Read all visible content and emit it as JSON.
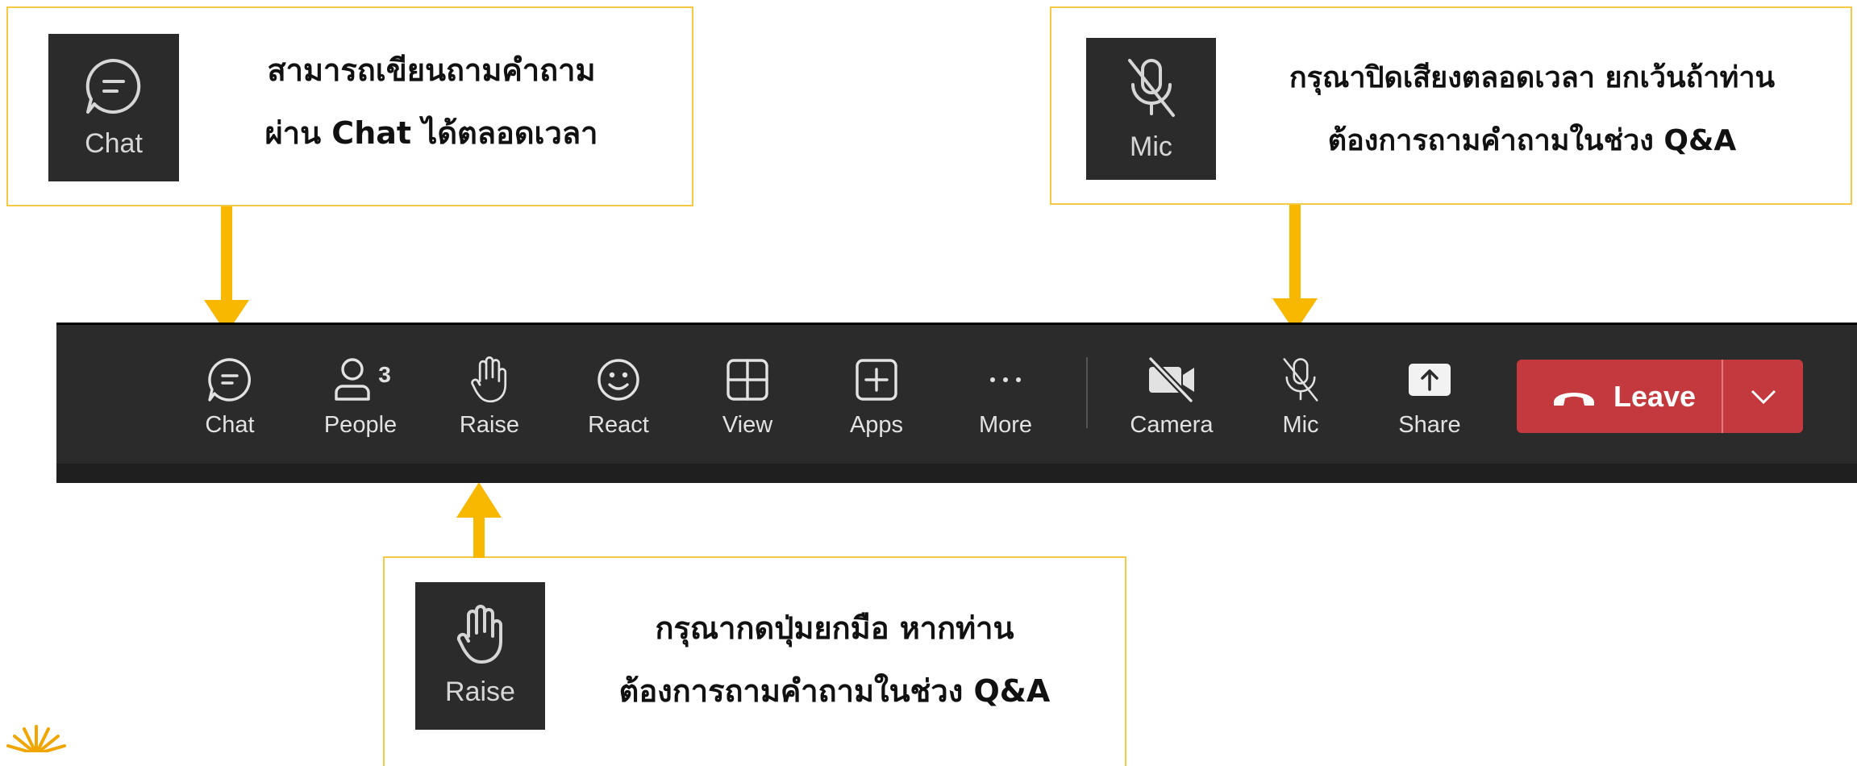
{
  "callouts": {
    "chat": {
      "tile_label": "Chat",
      "line1": "สามารถเขียนถามคำถาม",
      "line2": "ผ่าน Chat ได้ตลอดเวลา"
    },
    "mic": {
      "tile_label": "Mic",
      "line1": "กรุณาปิดเสียงตลอดเวลา ยกเว้นถ้าท่าน",
      "line2": "ต้องการถามคำถามในช่วง Q&A"
    },
    "raise": {
      "tile_label": "Raise",
      "line1": "กรุณากดปุ่มยกมือ หากท่าน",
      "line2": "ต้องการถามคำถามในช่วง Q&A"
    }
  },
  "toolbar": {
    "chat": "Chat",
    "people": "People",
    "people_count": "3",
    "raise": "Raise",
    "react": "React",
    "view": "View",
    "apps": "Apps",
    "more": "More",
    "camera": "Camera",
    "mic": "Mic",
    "share": "Share",
    "leave": "Leave"
  },
  "colors": {
    "arrow": "#f8b800",
    "callout_border": "#f6c945",
    "toolbar_bg": "#2b2b2b",
    "leave_bg": "#c4393d"
  }
}
